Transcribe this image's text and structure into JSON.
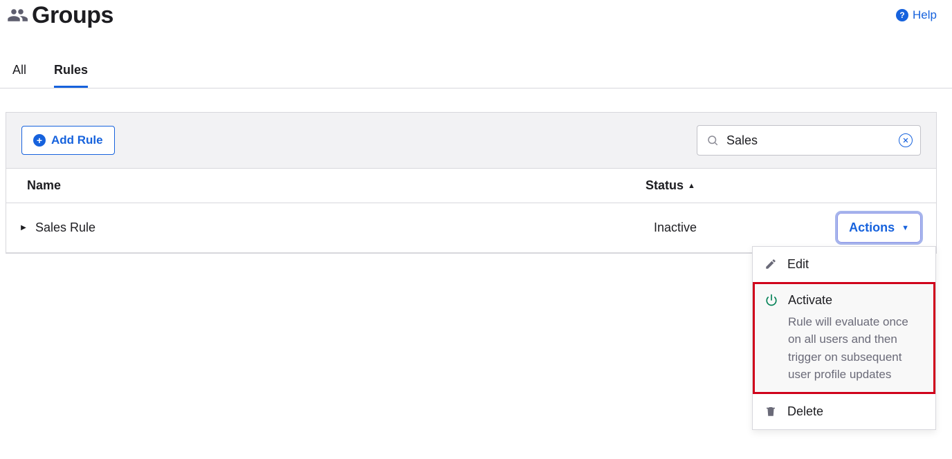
{
  "header": {
    "title": "Groups",
    "help_label": "Help"
  },
  "tabs": [
    {
      "label": "All",
      "active": false
    },
    {
      "label": "Rules",
      "active": true
    }
  ],
  "toolbar": {
    "add_rule_label": "Add Rule",
    "search_value": "Sales"
  },
  "table": {
    "columns": {
      "name": "Name",
      "status": "Status"
    },
    "sort_indicator": "▲",
    "rows": [
      {
        "name": "Sales Rule",
        "status": "Inactive",
        "actions_label": "Actions"
      }
    ]
  },
  "menu": {
    "edit": {
      "label": "Edit"
    },
    "activate": {
      "label": "Activate",
      "description": "Rule will evaluate once on all users and then trigger on subsequent user profile updates"
    },
    "delete": {
      "label": "Delete"
    }
  }
}
